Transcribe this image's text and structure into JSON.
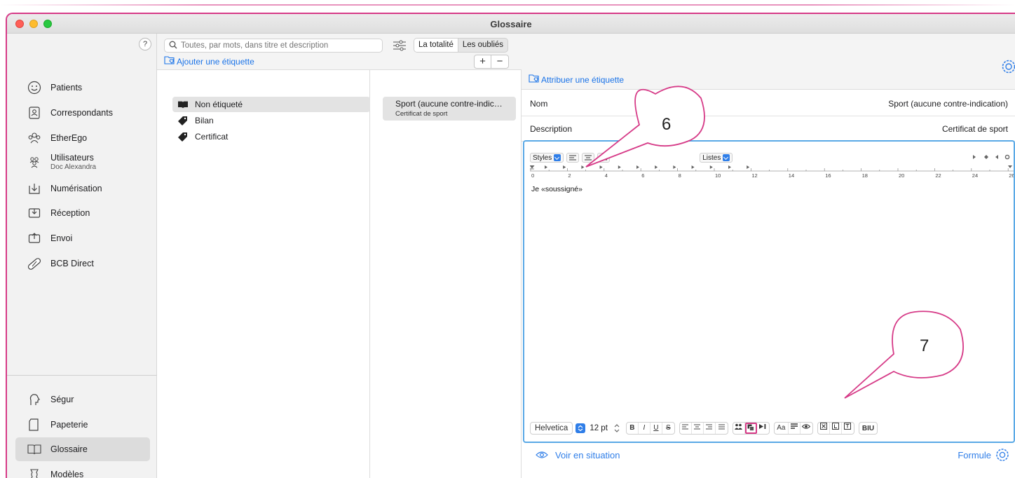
{
  "window": {
    "title": "Glossaire"
  },
  "sidebar": {
    "help": "?",
    "items": [
      {
        "label": "Patients",
        "icon": "smiley-icon"
      },
      {
        "label": "Correspondants",
        "icon": "contacts-book-icon"
      },
      {
        "label": "EtherEgo",
        "icon": "people-group-icon"
      },
      {
        "label": "Utilisateurs",
        "sub": "Doc Alexandra",
        "icon": "users-icon"
      },
      {
        "label": "Numérisation",
        "icon": "scan-tray-icon"
      },
      {
        "label": "Réception",
        "icon": "inbox-icon"
      },
      {
        "label": "Envoi",
        "icon": "outbox-icon"
      },
      {
        "label": "BCB Direct",
        "icon": "pill-icon"
      }
    ],
    "bottom_items": [
      {
        "label": "Ségur",
        "icon": "segur-icon"
      },
      {
        "label": "Papeterie",
        "icon": "paper-icon"
      },
      {
        "label": "Glossaire",
        "icon": "book-icon",
        "active": true
      },
      {
        "label": "Modèles",
        "icon": "template-icon"
      }
    ]
  },
  "list": {
    "search_placeholder": "Toutes, par mots, dans titre et description",
    "seg_all": "La totalité",
    "seg_forgotten": "Les oubliés",
    "add_tag": "Ajouter une étiquette",
    "plus": "+",
    "minus": "−",
    "tags": [
      {
        "label": "Non étiqueté",
        "icon": "book-open-icon",
        "selected": true
      },
      {
        "label": "Bilan",
        "icon": "tag-icon"
      },
      {
        "label": "Certificat",
        "icon": "tag-icon"
      }
    ],
    "entry": {
      "title": "Sport (aucune contre-indic…",
      "desc": "Certificat de sport"
    }
  },
  "detail": {
    "assign_tag": "Attribuer une étiquette",
    "name_label": "Nom",
    "name_value": "Sport (aucune contre-indication)",
    "desc_label": "Description",
    "desc_value": "Certificat de sport",
    "styles": "Styles",
    "lists": "Listes",
    "ruler_ticks": [
      "0",
      "2",
      "4",
      "6",
      "8",
      "10",
      "12",
      "14",
      "16",
      "18",
      "20",
      "22",
      "24",
      "26"
    ],
    "body_text": "Je «soussigné»",
    "font": "Helvetica",
    "size": "12 pt",
    "bold": "B",
    "italic": "I",
    "underline": "U",
    "strike": "S",
    "case": "Aa",
    "biu": "BIU",
    "voir": "Voir en situation",
    "formule": "Formule"
  },
  "callouts": {
    "six": "6",
    "seven": "7"
  },
  "colors": {
    "accent": "#2f7ee8",
    "callout": "#d63a87",
    "editor_border": "#5aa9e6"
  }
}
